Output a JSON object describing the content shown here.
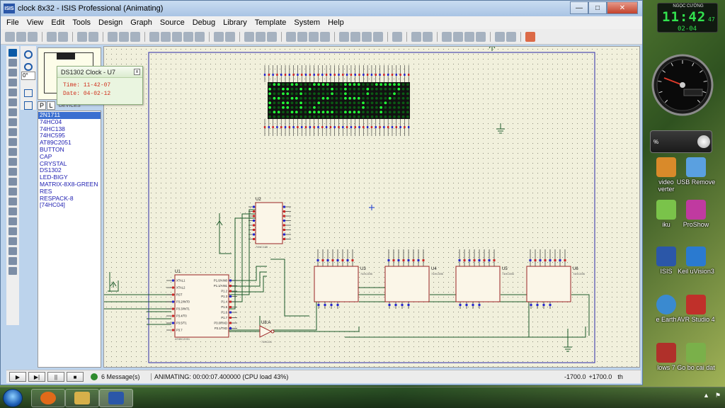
{
  "window": {
    "icon_text": "ISIS",
    "title": "clock 8x32 - ISIS Professional (Animating)",
    "min": "—",
    "max": "□",
    "close": "✕"
  },
  "menu": [
    "File",
    "View",
    "Edit",
    "Tools",
    "Design",
    "Graph",
    "Source",
    "Debug",
    "Library",
    "Template",
    "System",
    "Help"
  ],
  "mode_tabs": [
    "P",
    "L"
  ],
  "devices_header": "DEVICES",
  "angle": "0°",
  "devices": [
    "2N1711",
    "74HC04",
    "74HC138",
    "74HC595",
    "AT89C2051",
    "BUTTON",
    "CAP",
    "CRYSTAL",
    "DS1302",
    "LED-BIGY",
    "MATRIX-8X8-GREEN",
    "RES",
    "RESPACK-8",
    "[74HC04]"
  ],
  "selected_device": "2N1711",
  "popup": {
    "title": "DS1302 Clock - U7",
    "close": "x",
    "time_label": "Time:",
    "time_value": "11-42-07",
    "date_label": "Date:",
    "date_value": "04-02-12"
  },
  "schematic": {
    "u2_ref": "U2",
    "u2_part": "74HC138",
    "u1_ref": "U1",
    "u1_part": "AT89C2051",
    "u8_ref": "U8:A",
    "u8_part": "74HC04",
    "shift_regs": [
      {
        "ref": "U3",
        "part": "74HC595"
      },
      {
        "ref": "U4",
        "part": "74HC595"
      },
      {
        "ref": "U5",
        "part": "74HC595"
      },
      {
        "ref": "U6",
        "part": "74HC595"
      }
    ],
    "u1_left_pins": [
      "XTAL1",
      "XTAL2",
      "RST",
      "P3.2/INT0",
      "P3.3/INT1",
      "P3.4/T0",
      "P3.5/T1",
      "P3.7"
    ],
    "u1_right_pins": [
      "P1.0/AIN0",
      "P1.1/AIN1",
      "P1.2",
      "P1.3",
      "P1.4",
      "P1.5",
      "P1.6",
      "P1.7",
      "P3.0/RXD",
      "P3.1/TXD"
    ],
    "matrix_panels": 4
  },
  "status": {
    "play": "▶",
    "step": "▶|",
    "pause": "||",
    "stop": "■",
    "messages": "6 Message(s)",
    "animating": "ANIMATING: 00:00:07.400000 (CPU load 43%)",
    "coord_x": "-1700.0",
    "coord_y": "+1700.0",
    "units": "th"
  },
  "clock_gadget": {
    "title": "NGỌC CƯỜNG",
    "time": "11:42",
    "seconds": "47",
    "date": "02-04"
  },
  "volume_gadget": {
    "percent": "%"
  },
  "desktop_icons": [
    {
      "label": "video\nverter",
      "color": "#d98a2a"
    },
    {
      "label": "USB Remove",
      "color": "#5aa0e0"
    },
    {
      "label": "iku",
      "color": "#7ac34a"
    },
    {
      "label": "ProShow",
      "color": "#c03aa0"
    },
    {
      "label": "ISIS",
      "color": "#2b57a8"
    },
    {
      "label": "Keil uVision3",
      "color": "#2a7ad0"
    },
    {
      "label": "e Earth",
      "color": "#3a8ad0"
    },
    {
      "label": "AVR Studio 4",
      "color": "#c0302a"
    },
    {
      "label": "lows 7",
      "color": "#b0302a"
    },
    {
      "label": "Go bo cai dat",
      "color": "#7ab04a"
    }
  ],
  "taskbar": {
    "apps": [
      {
        "name": "Firefox",
        "color": "#e06a1a"
      },
      {
        "name": "Explorer",
        "color": "#d7b04a"
      },
      {
        "name": "ISIS",
        "color": "#2b57a8"
      }
    ],
    "tray_up": "▲",
    "tray_flag": "⚑"
  },
  "colors": {
    "led_on": "#23ff38",
    "led_off": "#0b5a14",
    "wire": "#1d5a2a",
    "chip_body": "#fbf6e8",
    "chip_border": "#9a2323",
    "selection": "#3b6fd0"
  }
}
